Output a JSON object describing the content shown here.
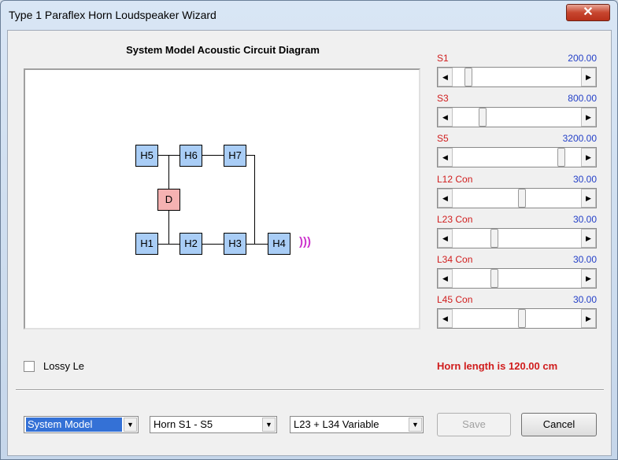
{
  "window": {
    "title": "Type 1 Paraflex Horn Loudspeaker Wizard",
    "close_glyph": "✕"
  },
  "diagram": {
    "title": "System Model Acoustic Circuit Diagram",
    "nodes": {
      "H1": "H1",
      "H2": "H2",
      "H3": "H3",
      "H4": "H4",
      "H5": "H5",
      "H6": "H6",
      "H7": "H7",
      "D": "D"
    },
    "sound_glyph": ")))"
  },
  "sliders": [
    {
      "name": "S1",
      "value": "200.00",
      "position": 0.1
    },
    {
      "name": "S3",
      "value": "800.00",
      "position": 0.22
    },
    {
      "name": "S5",
      "value": "3200.00",
      "position": 0.88
    },
    {
      "name": "L12  Con",
      "value": "30.00",
      "position": 0.55
    },
    {
      "name": "L23  Con",
      "value": "30.00",
      "position": 0.32
    },
    {
      "name": "L34  Con",
      "value": "30.00",
      "position": 0.32
    },
    {
      "name": "L45  Con",
      "value": "30.00",
      "position": 0.55
    }
  ],
  "lossy": {
    "label": "Lossy Le",
    "checked": false
  },
  "status": {
    "horn_length": "Horn length is 120.00 cm"
  },
  "bottom": {
    "model_select": "System Model",
    "horn_select": "Horn S1 - S5",
    "variable_select": "L23 + L34 Variable",
    "save_label": "Save",
    "cancel_label": "Cancel"
  },
  "colors": {
    "label_red": "#d01c1c",
    "value_blue": "#2440c8",
    "node_blue": "#a9cdf6",
    "node_pink": "#f5b2b2",
    "sound_magenta": "#cc33cc"
  },
  "icons": {
    "arrow_left": "left-arrow-icon",
    "arrow_right": "right-arrow-icon",
    "dropdown": "chevron-down-icon"
  }
}
